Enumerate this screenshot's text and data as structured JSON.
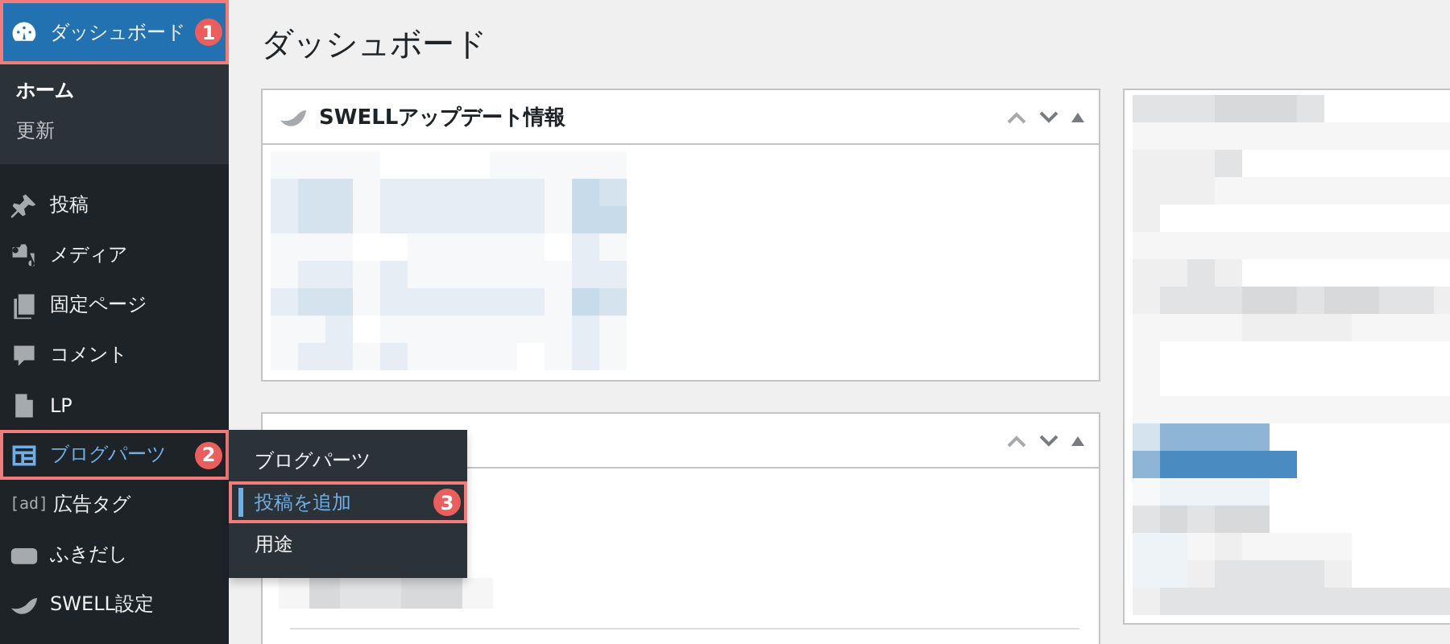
{
  "sidebar": {
    "items": [
      {
        "label": "ダッシュボード",
        "selected": true,
        "open": false,
        "highlighted": true,
        "badge": "1",
        "children": [
          {
            "label": "ホーム",
            "selected": true
          },
          {
            "label": "更新",
            "selected": false
          }
        ]
      },
      {
        "label": "投稿",
        "selected": false,
        "open": false,
        "highlighted": false
      },
      {
        "label": "メディア",
        "selected": false,
        "open": false,
        "highlighted": false
      },
      {
        "label": "固定ページ",
        "selected": false,
        "open": false,
        "highlighted": false
      },
      {
        "label": "コメント",
        "selected": false,
        "open": false,
        "highlighted": false
      },
      {
        "label": "LP",
        "selected": false,
        "open": false,
        "highlighted": false
      },
      {
        "label": "ブログパーツ",
        "selected": false,
        "open": true,
        "highlighted": true,
        "badge": "2",
        "flyout": [
          {
            "label": "ブログパーツ",
            "selected": false,
            "highlighted": false
          },
          {
            "label": "投稿を追加",
            "selected": true,
            "highlighted": true,
            "badge": "3"
          },
          {
            "label": "用途",
            "selected": false,
            "highlighted": false
          }
        ]
      },
      {
        "label": "広告タグ",
        "icon_text": "[ad]",
        "selected": false,
        "open": false,
        "highlighted": false
      },
      {
        "label": "ふきだし",
        "selected": false,
        "open": false,
        "highlighted": false
      },
      {
        "label": "SWELL設定",
        "selected": false,
        "open": false,
        "highlighted": false
      }
    ]
  },
  "page_title": "ダッシュボード",
  "panels": [
    {
      "title": "SWELLアップデート情報"
    }
  ]
}
